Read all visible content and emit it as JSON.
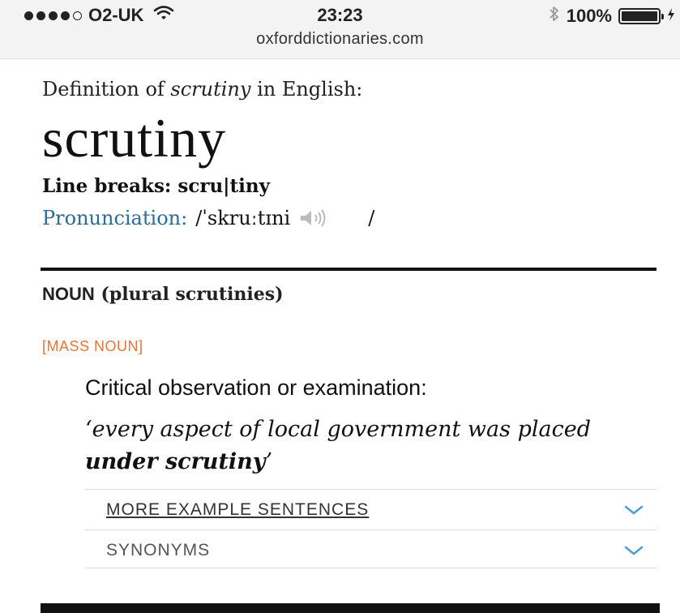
{
  "status_bar": {
    "carrier": "O2-UK",
    "time": "23:23",
    "battery": "100%",
    "url": "oxforddictionaries.com",
    "signal_bars": 4
  },
  "entry": {
    "heading_prefix": "Definition of ",
    "heading_word": "scrutiny",
    "heading_suffix": " in English:",
    "headword": "scrutiny",
    "line_breaks": "Line breaks: scru|tiny",
    "pronunciation_label": "Pronunciation:",
    "pronunciation_value": "/ˈskruːtɪni",
    "pronunciation_end": "/",
    "part_of_speech": "NOUN",
    "plural_note": "(plural scrutinies)",
    "grammar_label": "[MASS NOUN]",
    "definition": "Critical observation or examination:",
    "example_part1": "‘every aspect of local government was placed ",
    "example_bold": "under scrutiny",
    "example_end": "’"
  },
  "accordions": {
    "more_examples": "MORE EXAMPLE SENTENCES",
    "synonyms": "SYNONYMS"
  },
  "icons": {
    "wifi": "wifi-icon",
    "bluetooth": "bluetooth-icon",
    "battery": "battery-icon",
    "speaker": "speaker-icon",
    "chevron": "chevron-down-icon",
    "charging": "charging-icon"
  },
  "colors": {
    "pronunciation_label": "#2b6b96",
    "grammar_label": "#e9743c",
    "chevron": "#4a9fd8"
  }
}
